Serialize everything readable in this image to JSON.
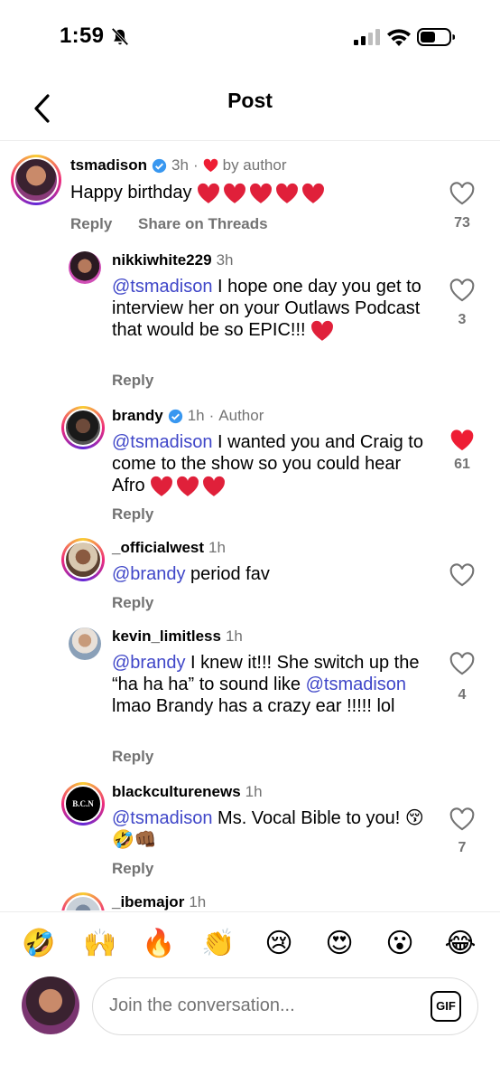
{
  "status_bar": {
    "time": "1:59"
  },
  "header": {
    "title": "Post"
  },
  "comments": [
    {
      "username": "tsmadison",
      "verified": true,
      "time": "3h",
      "separator": "·",
      "tag": "by author",
      "text": "Happy birthday",
      "reply": "Reply",
      "share": "Share on Threads",
      "likes": "73",
      "liked": false
    },
    {
      "username": "nikkiwhite229",
      "verified": false,
      "time": "3h",
      "mention": "@tsmadison",
      "text": "I hope one day you get to interview her on your Outlaws Podcast that would be so EPIC!!!",
      "reply": "Reply",
      "likes": "3",
      "liked": false
    },
    {
      "username": "brandy",
      "verified": true,
      "time": "1h",
      "separator": "·",
      "tag": "Author",
      "mention": "@tsmadison",
      "text": "I wanted you and Craig to come to the show so you could hear Afro",
      "reply": "Reply",
      "likes": "61",
      "liked": true
    },
    {
      "username": "_officialwest",
      "verified": false,
      "time": "1h",
      "mention": "@brandy",
      "text": "period fav",
      "reply": "Reply",
      "likes": "",
      "liked": false
    },
    {
      "username": "kevin_limitless",
      "verified": false,
      "time": "1h",
      "mention": "@brandy",
      "text": "I knew it!!! She switch up the “ha ha ha” to sound like",
      "mention2": "@tsmadison",
      "text2": "lmao Brandy has a crazy ear !!!!! lol",
      "reply": "Reply",
      "likes": "4",
      "liked": false
    },
    {
      "username": "blackculturenews",
      "verified": false,
      "time": "1h",
      "mention": "@tsmadison",
      "text": "Ms. Vocal Bible to you! 😚🤣👊🏾",
      "reply": "Reply",
      "likes": "7",
      "liked": false,
      "avatar_text": "B.C.N"
    },
    {
      "username": "_ibemajor",
      "verified": false,
      "time": "1h"
    }
  ],
  "emoji_bar": [
    "🤣",
    "🙌",
    "🔥",
    "👏",
    "😢",
    "😍",
    "😮",
    "😂"
  ],
  "composer": {
    "placeholder": "Join the conversation...",
    "gif_label": "GIF"
  },
  "colors": {
    "mention": "#3f46c8",
    "like_red": "#ee1d34",
    "muted": "#737373",
    "verified": "#3897f0"
  }
}
